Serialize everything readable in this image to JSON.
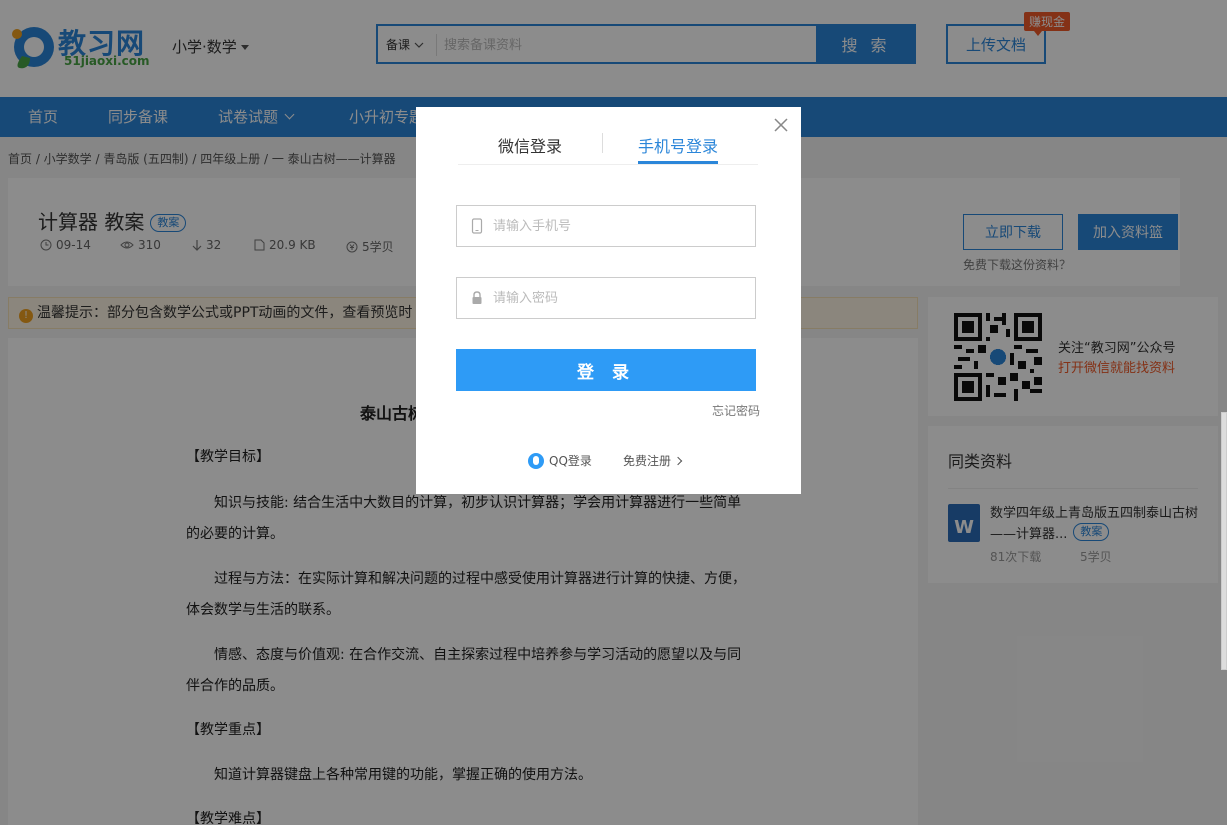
{
  "header": {
    "logo_text": "教习网",
    "logo_url": "51jiaoxi.com",
    "subject": "小学·数学",
    "search_category": "备课",
    "search_placeholder": "搜索备课资料",
    "search_button": "搜 索",
    "upload_button": "上传文档",
    "earn_badge": "赚现金"
  },
  "nav": {
    "items": [
      "首页",
      "同步备课",
      "试卷试题",
      "小升初专题"
    ]
  },
  "breadcrumb": "首页 / 小学数学 / 青岛版 (五四制) / 四年级上册 / 一 泰山古树——计算器",
  "doc": {
    "title": "计算器 教案",
    "tag": "教案",
    "date": "09-14",
    "views": "310",
    "downloads": "32",
    "size": "20.9 KB",
    "price": "5学贝",
    "download_button": "立即下载",
    "basket_button": "加入资料篮",
    "free_download": "免费下载这份资料？",
    "tip": "温馨提示：部分包含数学公式或PPT动画的文件，查看预览时",
    "heading": "泰山古树",
    "lines": [
      "【教学目标】",
      "知识与技能: 结合生活中大数目的计算，初步认识计算器；学会用计算器进行一些简单",
      "的必要的计算。",
      "过程与方法：在实际计算和解决问题的过程中感受使用计算器进行计算的快捷、方便，",
      "体会数学与生活的联系。",
      "情感、态度与价值观: 在合作交流、自主探索过程中培养参与学习活动的愿望以及与同",
      "伴合作的品质。",
      "【教学重点】",
      "知道计算器键盘上各种常用键的功能，掌握正确的使用方法。",
      "【教学难点】"
    ]
  },
  "sidebar": {
    "qr_line1": "关注“教习网”公众号",
    "qr_line2": "打开微信就能找资料",
    "similar_title": "同类资料",
    "similar_doc_title": "数学四年级上青岛版五四制泰山古树——计算器...",
    "similar_doc_tag": "教案",
    "similar_doc_downloads": "81次下载",
    "similar_doc_price": "5学贝"
  },
  "modal": {
    "tab_wechat": "微信登录",
    "tab_phone": "手机号登录",
    "phone_placeholder": "请输入手机号",
    "password_placeholder": "请输入密码",
    "login_button": "登 录",
    "forgot": "忘记密码",
    "qq_login": "QQ登录",
    "register": "免费注册"
  },
  "colors": {
    "brand_blue": "#2b86d9",
    "login_blue": "#2e9bf6",
    "accent_orange": "#f05a28"
  }
}
